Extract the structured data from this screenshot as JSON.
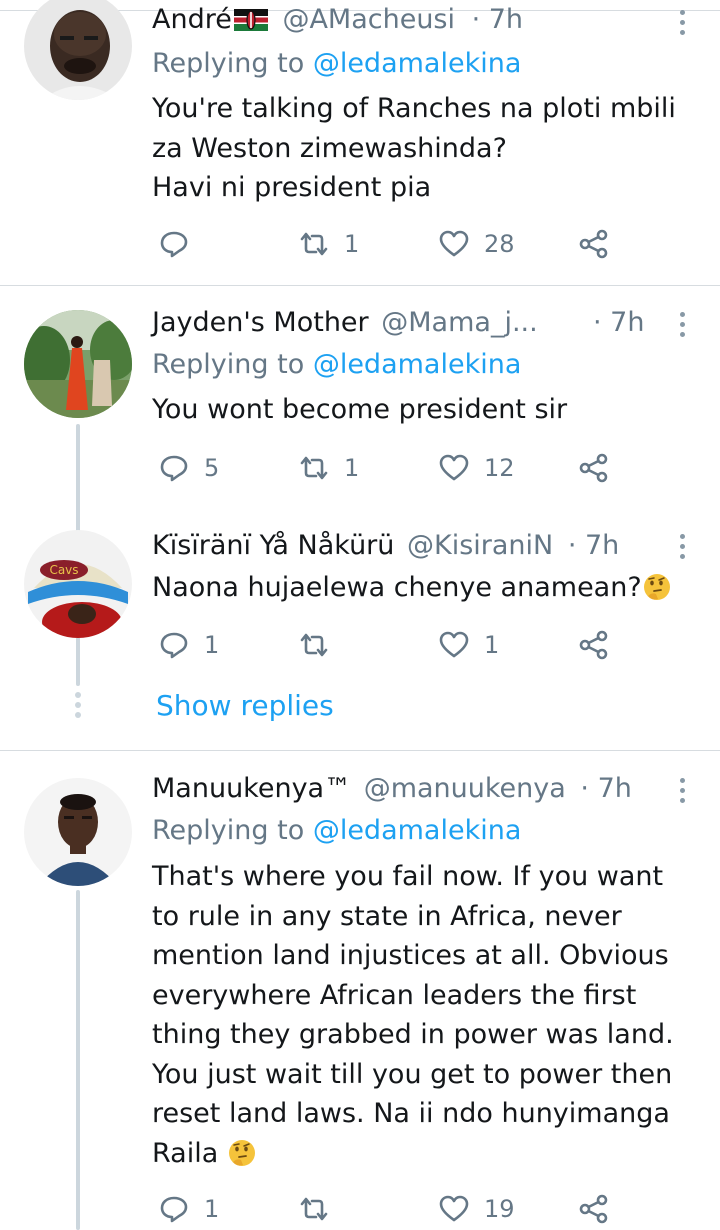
{
  "tweets": [
    {
      "name": "André",
      "handle": "@AMacheusi",
      "time": "· 7h",
      "replying_prefix": "Replying to ",
      "replying_to": "@ledamalekina",
      "lines": [
        "You're talking of Ranches na ploti mbili",
        "za Weston zimewashinda?",
        "Havi ni president pia"
      ],
      "retweets": "1",
      "likes": "28",
      "flag_icon": "kenya-flag-icon"
    },
    {
      "name": "Jayden's Mother",
      "handle": "@Mama_j...",
      "time": "· 7h",
      "replying_prefix": "Replying to ",
      "replying_to": "@ledamalekina",
      "lines": [
        "You wont become president sir"
      ],
      "replies": "5",
      "retweets": "1",
      "likes": "12"
    },
    {
      "name": "Kïsïränï Yå Nåkürü",
      "handle": "@KisiraniN",
      "time": "· 7h",
      "lines": [
        "Naona hujaelewa chenye anamean?"
      ],
      "replies": "1",
      "likes": "1",
      "emoji_icon": "thinking-face-icon"
    },
    {
      "name": "Manuukenya™",
      "handle": "@manuukenya",
      "time": "· 7h",
      "replying_prefix": "Replying to ",
      "replying_to": "@ledamalekina",
      "lines": [
        "That's where you fail now. If you want",
        "to rule in any state in Africa, never",
        "mention land injustices at all. Obvious",
        "everywhere African leaders the first",
        "thing they grabbed in power was land.",
        "You just wait till you get to power then",
        "reset land laws. Na ii ndo hunyimanga",
        "Raila"
      ],
      "replies": "1",
      "likes": "19",
      "emoji_icon": "thinking-face-icon"
    }
  ],
  "show_replies": "Show replies",
  "colors": {
    "accent": "#1da1f2",
    "secondary_text": "#657786",
    "primary_text": "#14171a",
    "divider": "#d7dce0",
    "thread_line": "#ccd6dd"
  }
}
